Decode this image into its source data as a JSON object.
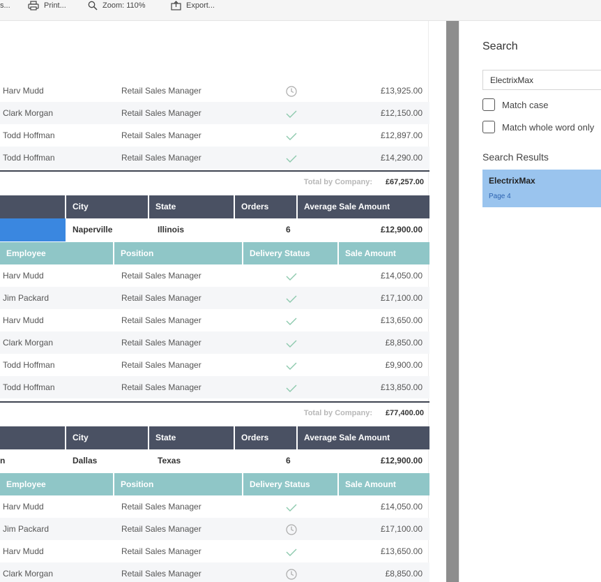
{
  "toolbar": {
    "items": [
      {
        "label": "s...",
        "icon": "save-icon"
      },
      {
        "label": "Print...",
        "icon": "printer-icon"
      },
      {
        "label": "Zoom: 110%",
        "icon": "zoom-icon"
      },
      {
        "label": "Export...",
        "icon": "export-icon"
      }
    ]
  },
  "report": {
    "top_rows": [
      {
        "employee": "Harv Mudd",
        "position": "Retail Sales Manager",
        "status": "pending",
        "amount": "£13,925.00"
      },
      {
        "employee": "Clark Morgan",
        "position": "Retail Sales Manager",
        "status": "delivered",
        "amount": "£12,150.00"
      },
      {
        "employee": "Todd Hoffman",
        "position": "Retail Sales Manager",
        "status": "delivered",
        "amount": "£12,897.00"
      },
      {
        "employee": "Todd Hoffman",
        "position": "Retail Sales Manager",
        "status": "delivered",
        "amount": "£14,290.00"
      }
    ],
    "total_label": "Total by Company:",
    "total_1": "£67,257.00",
    "total_2": "£77,400.00",
    "company_headers": {
      "city": "City",
      "state": "State",
      "orders": "Orders",
      "avg": "Average Sale Amount"
    },
    "detail_headers": {
      "employee": "Employee",
      "position": "Position",
      "delivery": "Delivery Status",
      "amount": "Sale Amount"
    },
    "company_2": {
      "name": "",
      "city": "Naperville",
      "state": "Illinois",
      "orders": "6",
      "avg": "£12,900.00"
    },
    "rows_2": [
      {
        "employee": "Harv Mudd",
        "position": "Retail Sales Manager",
        "status": "delivered",
        "amount": "£14,050.00"
      },
      {
        "employee": "Jim Packard",
        "position": "Retail Sales Manager",
        "status": "delivered",
        "amount": "£17,100.00"
      },
      {
        "employee": "Harv Mudd",
        "position": "Retail Sales Manager",
        "status": "delivered",
        "amount": "£13,650.00"
      },
      {
        "employee": "Clark Morgan",
        "position": "Retail Sales Manager",
        "status": "delivered",
        "amount": "£8,850.00"
      },
      {
        "employee": "Todd Hoffman",
        "position": "Retail Sales Manager",
        "status": "delivered",
        "amount": "£9,900.00"
      },
      {
        "employee": "Todd Hoffman",
        "position": "Retail Sales Manager",
        "status": "delivered",
        "amount": "£13,850.00"
      }
    ],
    "company_3": {
      "name": "n",
      "city": "Dallas",
      "state": "Texas",
      "orders": "6",
      "avg": "£12,900.00"
    },
    "rows_3": [
      {
        "employee": "Harv Mudd",
        "position": "Retail Sales Manager",
        "status": "delivered",
        "amount": "£14,050.00"
      },
      {
        "employee": "Jim Packard",
        "position": "Retail Sales Manager",
        "status": "pending",
        "amount": "£17,100.00"
      },
      {
        "employee": "Harv Mudd",
        "position": "Retail Sales Manager",
        "status": "delivered",
        "amount": "£13,650.00"
      },
      {
        "employee": "Clark Morgan",
        "position": "Retail Sales Manager",
        "status": "pending",
        "amount": "£8,850.00"
      }
    ]
  },
  "search": {
    "title": "Search",
    "query": "ElectrixMax",
    "match_case_label": "Match case",
    "match_case_checked": false,
    "whole_word_label": "Match whole word only",
    "whole_word_checked": false,
    "results_title": "Search Results",
    "results": [
      {
        "title": "ElectrixMax",
        "page": "Page 4"
      }
    ]
  },
  "colors": {
    "dark_header": "#4a5163",
    "teal_header": "#8fc6c7",
    "selection": "#3a87e0",
    "result_highlight": "#9ac4ee",
    "check_green": "#8cc9ad",
    "splitter": "#8d8d8d"
  }
}
